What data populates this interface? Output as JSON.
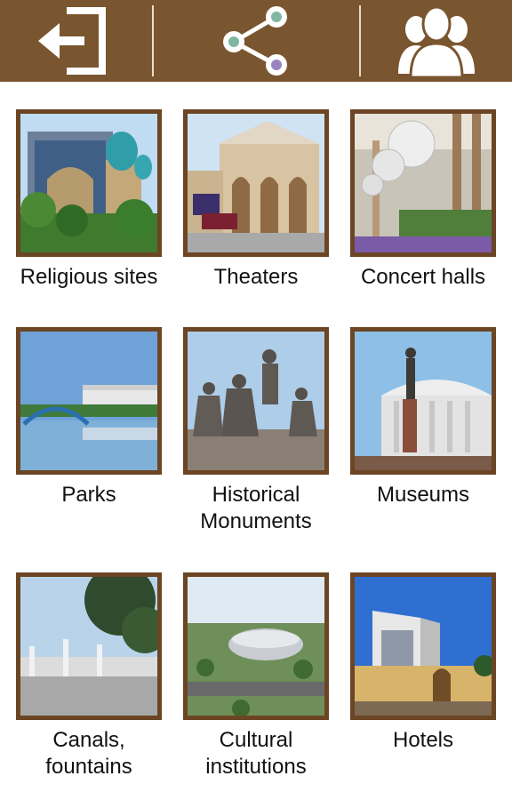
{
  "toolbar": {
    "back_icon": "exit-arrow-icon",
    "share_icon": "share-icon",
    "users_icon": "users-group-icon",
    "background": "#7a5630"
  },
  "categories": [
    {
      "label": "Religious sites",
      "icon": "mosque-photo"
    },
    {
      "label": "Theaters",
      "icon": "theater-photo"
    },
    {
      "label": "Concert halls",
      "icon": "concert-hall-photo"
    },
    {
      "label": "Parks",
      "icon": "park-photo"
    },
    {
      "label": "Historical\nMonuments",
      "icon": "monument-photo"
    },
    {
      "label": "Museums",
      "icon": "museum-photo"
    },
    {
      "label": "Canals,\nfountains",
      "icon": "fountain-photo"
    },
    {
      "label": "Cultural\ninstitutions",
      "icon": "cultural-photo"
    },
    {
      "label": "Hotels",
      "icon": "hotel-photo"
    }
  ]
}
